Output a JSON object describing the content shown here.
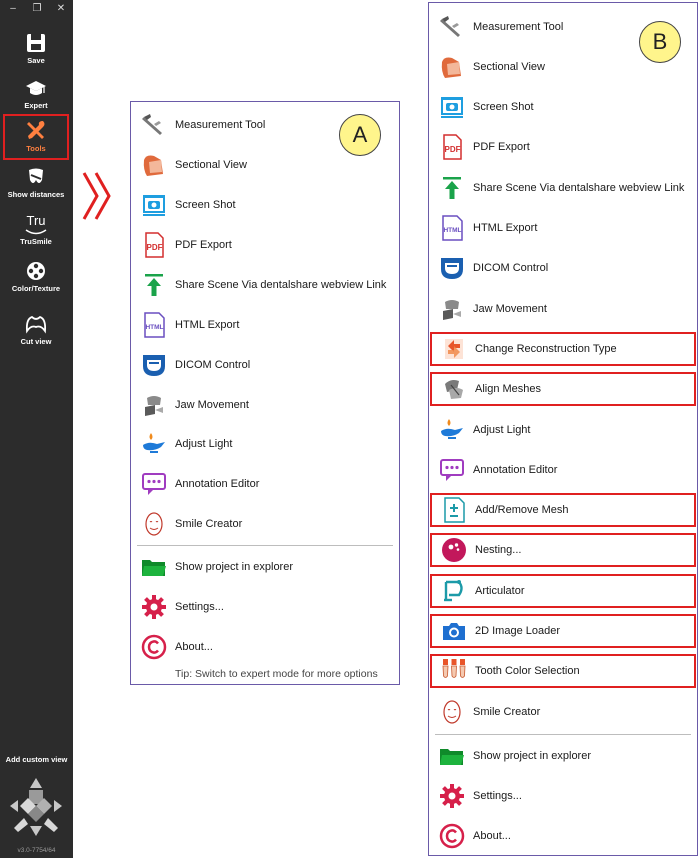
{
  "window_controls": {
    "minimize": "–",
    "restore": "❐",
    "close": "✕"
  },
  "sidebar": {
    "items": [
      {
        "label": "Save"
      },
      {
        "label": "Expert"
      },
      {
        "label": "Tools",
        "active": true
      },
      {
        "label": "Show distances"
      },
      {
        "label": "TruSmile",
        "icon_text": "Tru"
      },
      {
        "label": "Color/Texture"
      },
      {
        "label": "Cut view"
      }
    ],
    "add_custom_view": "Add custom view",
    "version": "v3.0-7754/64"
  },
  "menu_a": {
    "badge": "A",
    "items": [
      {
        "label": "Measurement Tool",
        "icon": "caliper-icon"
      },
      {
        "label": "Sectional View",
        "icon": "sectional-view-icon"
      },
      {
        "label": "Screen Shot",
        "icon": "camera-icon"
      },
      {
        "label": "PDF Export",
        "icon": "pdf-icon",
        "icon_text": "PDF"
      },
      {
        "label": "Share Scene Via dentalshare webview Link",
        "icon": "share-upload-icon"
      },
      {
        "label": "HTML Export",
        "icon": "html-file-icon",
        "icon_text": "HTML"
      },
      {
        "label": "DICOM Control",
        "icon": "dicom-icon"
      },
      {
        "label": "Jaw Movement",
        "icon": "jaw-movement-icon"
      },
      {
        "label": "Adjust Light",
        "icon": "oil-lamp-icon"
      },
      {
        "label": "Annotation Editor",
        "icon": "annotation-icon"
      },
      {
        "label": "Smile Creator",
        "icon": "face-icon"
      },
      {
        "label": "Show project in explorer",
        "icon": "folder-icon"
      },
      {
        "label": "Settings...",
        "icon": "gear-icon"
      },
      {
        "label": "About...",
        "icon": "copyright-icon"
      }
    ],
    "tip": "Tip: Switch to expert mode for more options"
  },
  "menu_b": {
    "badge": "B",
    "items": [
      {
        "label": "Measurement Tool",
        "icon": "caliper-icon"
      },
      {
        "label": "Sectional View",
        "icon": "sectional-view-icon"
      },
      {
        "label": "Screen Shot",
        "icon": "camera-icon"
      },
      {
        "label": "PDF Export",
        "icon": "pdf-icon",
        "icon_text": "PDF"
      },
      {
        "label": "Share Scene Via dentalshare webview Link",
        "icon": "share-upload-icon"
      },
      {
        "label": "HTML Export",
        "icon": "html-file-icon",
        "icon_text": "HTML"
      },
      {
        "label": "DICOM Control",
        "icon": "dicom-icon"
      },
      {
        "label": "Jaw Movement",
        "icon": "jaw-movement-icon"
      },
      {
        "label": "Change Reconstruction Type",
        "icon": "reconstruction-icon",
        "highlighted": true
      },
      {
        "label": "Align Meshes",
        "icon": "align-meshes-icon",
        "highlighted": true
      },
      {
        "label": "Adjust Light",
        "icon": "oil-lamp-icon"
      },
      {
        "label": "Annotation Editor",
        "icon": "annotation-icon"
      },
      {
        "label": "Add/Remove Mesh",
        "icon": "add-remove-mesh-icon",
        "highlighted": true
      },
      {
        "label": "Nesting...",
        "icon": "nesting-icon",
        "highlighted": true
      },
      {
        "label": "Articulator",
        "icon": "articulator-icon",
        "highlighted": true
      },
      {
        "label": "2D Image Loader",
        "icon": "camera-2d-icon",
        "highlighted": true
      },
      {
        "label": "Tooth Color Selection",
        "icon": "tooth-shade-icon",
        "highlighted": true
      },
      {
        "label": "Smile Creator",
        "icon": "face-icon"
      },
      {
        "label": "Show project in explorer",
        "icon": "folder-icon"
      },
      {
        "label": "Settings...",
        "icon": "gear-icon"
      },
      {
        "label": "About...",
        "icon": "copyright-icon"
      }
    ]
  },
  "colors": {
    "sidebar_bg": "#2c2c2c",
    "highlight_border": "#e02020",
    "menu_border": "#6a5aa8",
    "badge_fill": "#fff58c",
    "tools_accent": "#ff8040"
  }
}
